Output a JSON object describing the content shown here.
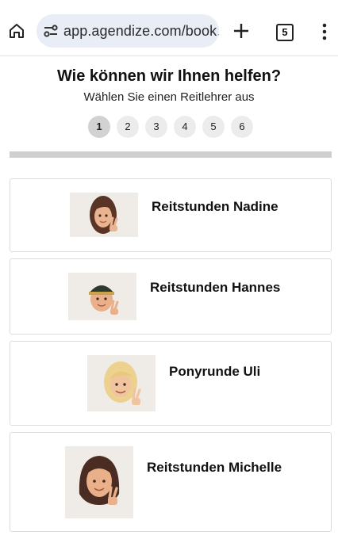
{
  "browser": {
    "url": "app.agendize.com/book,",
    "tab_count": "5"
  },
  "page": {
    "title": "Wie können wir Ihnen helfen?",
    "subtitle": "Wählen Sie einen Reitlehrer aus",
    "steps": [
      "1",
      "2",
      "3",
      "4",
      "5",
      "6"
    ],
    "active_step": "1"
  },
  "instructors": [
    {
      "name": "Reitstunden Nadine",
      "avatar": "memoji-woman-brown-hair"
    },
    {
      "name": "Reitstunden Hannes",
      "avatar": "memoji-man-cap"
    },
    {
      "name": "Ponyrunde Uli",
      "avatar": "memoji-blonde"
    },
    {
      "name": "Reitstunden Michelle",
      "avatar": "memoji-woman-bangs"
    }
  ]
}
